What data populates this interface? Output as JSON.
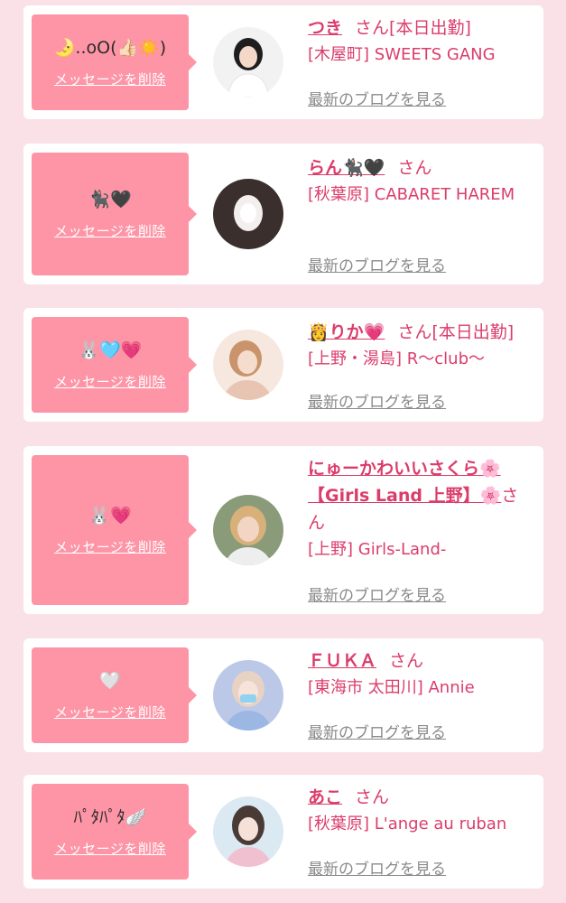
{
  "delete_label": "メッセージを削除",
  "blog_label": "最新のブログを見る",
  "san_label": "さん",
  "colors": {
    "page_background": "#f9e1e7",
    "card_background": "#ffffff",
    "bubble": "#fd95a6",
    "accent_text": "#db3d6b",
    "link_gray": "#8a8a8a"
  },
  "entries": [
    {
      "message": "🌛..oO(👍🏻☀️)",
      "name": "つき",
      "status": "[本日出勤]",
      "shop": "[木屋町] SWEETS GANG",
      "avatar_icon": "profile-photo-icon"
    },
    {
      "message": "🐈‍⬛🖤",
      "name": "らん🐈‍⬛🖤",
      "status": "",
      "shop": "[秋葉原] CABARET HAREM",
      "avatar_icon": "profile-photo-icon"
    },
    {
      "message": "🐰🩵💗",
      "name": "👸りか💗",
      "status": "[本日出勤]",
      "shop": "[上野・湯島] R〜club〜",
      "avatar_icon": "profile-photo-icon"
    },
    {
      "message": "🐰💗",
      "name": "にゅーかわいいさくら🌸【Girls Land 上野】🌸",
      "status": "",
      "shop": "[上野] Girls-Land-",
      "avatar_icon": "profile-photo-icon"
    },
    {
      "message": "🤍",
      "name": "ＦＵＫＡ",
      "status": "",
      "shop": "[東海市 太田川] Annie",
      "avatar_icon": "profile-photo-icon"
    },
    {
      "message": "ﾊﾟﾀﾊﾟﾀ🪽",
      "name": "あこ",
      "status": "",
      "shop": "[秋葉原] L'ange au ruban",
      "avatar_icon": "profile-photo-icon"
    }
  ]
}
